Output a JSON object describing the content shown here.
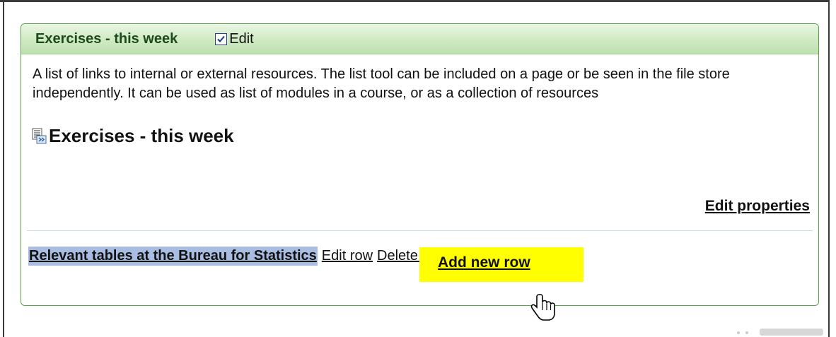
{
  "panel": {
    "title": "Exercises - this week",
    "edit_label": "Edit",
    "edit_checked": true,
    "description": "A list of links to internal or external resources. The list tool can be included on a page or be seen in the file store independently. It can be used as list of modules in a course, or as a collection of resources",
    "list_title": "Exercises - this week",
    "list_icon": "list-document-icon",
    "edit_properties_label": "Edit properties"
  },
  "rows": [
    {
      "link_label": "Relevant tables at the Bureau for Statistics",
      "edit_label": "Edit row",
      "delete_label": "Delete row"
    }
  ],
  "actions": {
    "add_row_label": "Add new row"
  },
  "colors": {
    "panel_border": "#56a447",
    "header_gradient_top": "#e9f6e3",
    "header_gradient_bottom": "#bfe0b0",
    "row_highlight": "#a9bde3",
    "add_row_highlight": "#ffff00"
  }
}
